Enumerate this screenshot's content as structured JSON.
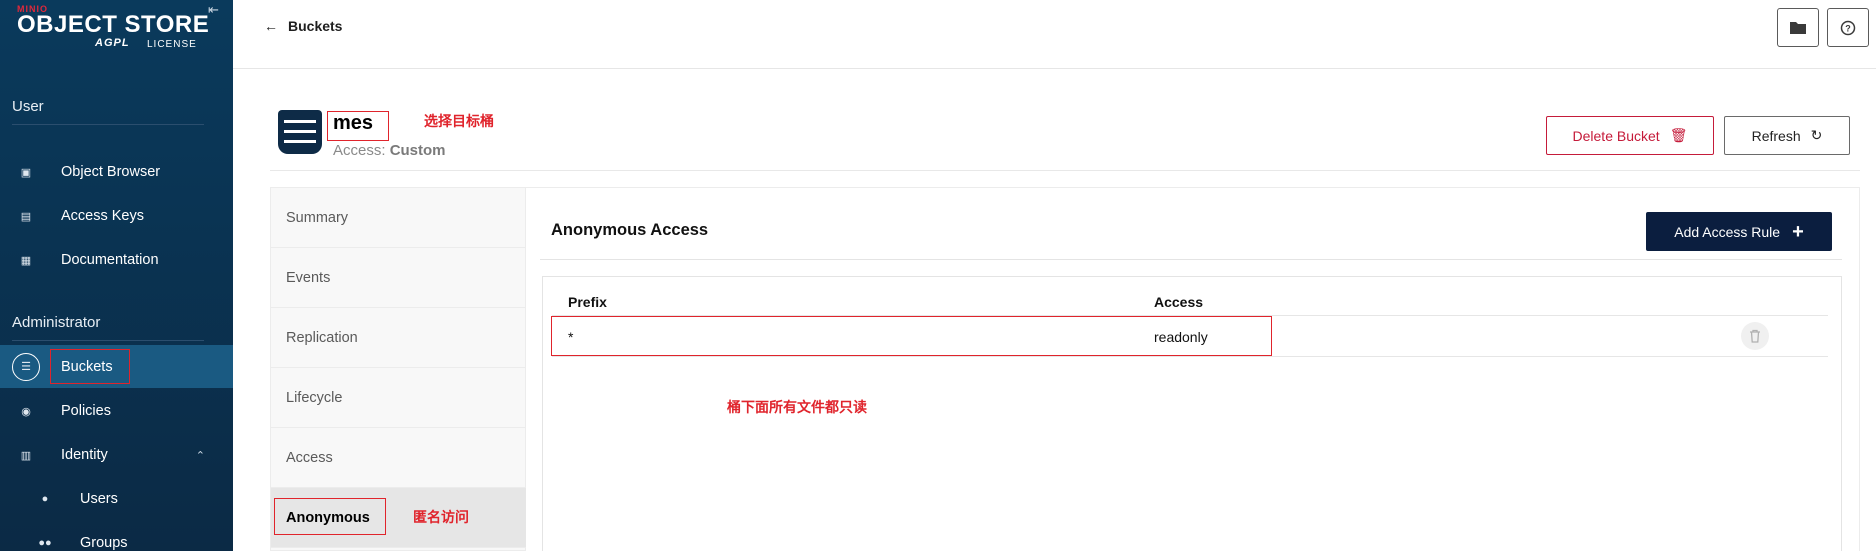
{
  "sidebar": {
    "logo": {
      "brand": "MINIO",
      "name": "OBJECT STORE",
      "license_badge": "AGPL",
      "license": "LICENSE"
    },
    "sections": {
      "user": "User",
      "admin": "Administrator"
    },
    "user_items": [
      {
        "label": "Object Browser",
        "icon": "object-browser-icon"
      },
      {
        "label": "Access Keys",
        "icon": "access-keys-icon"
      },
      {
        "label": "Documentation",
        "icon": "documentation-icon"
      }
    ],
    "admin_items": [
      {
        "label": "Buckets",
        "icon": "buckets-icon",
        "active": true
      },
      {
        "label": "Policies",
        "icon": "policies-icon"
      },
      {
        "label": "Identity",
        "icon": "identity-icon",
        "expanded": true
      },
      {
        "label": "Users",
        "icon": "user-icon"
      },
      {
        "label": "Groups",
        "icon": "groups-icon"
      }
    ]
  },
  "header": {
    "back_label": "Buckets"
  },
  "bucket": {
    "name": "mes",
    "access_label": "Access:",
    "access_value": "Custom",
    "delete_label": "Delete Bucket",
    "refresh_label": "Refresh"
  },
  "tabs": [
    "Summary",
    "Events",
    "Replication",
    "Lifecycle",
    "Access",
    "Anonymous"
  ],
  "selected_tab": "Anonymous",
  "panel": {
    "title": "Anonymous Access",
    "add_label": "Add Access Rule",
    "columns": [
      "Prefix",
      "Access"
    ],
    "rows": [
      {
        "prefix": "*",
        "access": "readonly"
      }
    ]
  },
  "annotations": {
    "select_bucket": "选择目标桶",
    "anonymous_access": "匿名访问",
    "all_readonly": "桶下面所有文件都只读"
  },
  "colors": {
    "sidebar": "#0b2a45",
    "active": "#1a5a82",
    "danger": "#c51b3a",
    "primary_button": "#0b1e3f",
    "annotation": "#e0242c"
  }
}
